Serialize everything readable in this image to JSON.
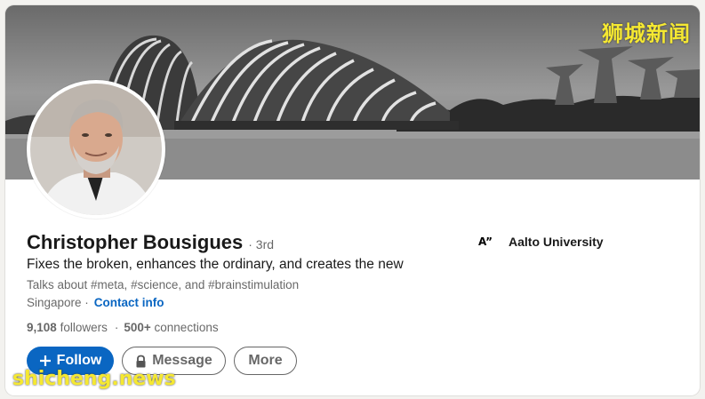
{
  "banner": {
    "watermark": "狮城新闻"
  },
  "profile": {
    "name": "Christopher Bousigues",
    "degree": "· 3rd",
    "headline": "Fixes the broken, enhances the ordinary, and creates the new",
    "talks_about": "Talks about #meta, #science, and #brainstimulation",
    "location": "Singapore ·",
    "contact_label": "Contact info",
    "followers": "9,108",
    "followers_label": "followers",
    "connections": "500+",
    "connections_label": "connections"
  },
  "education": {
    "logo_text": "A”",
    "name": "Aalto University"
  },
  "actions": {
    "follow_label": "Follow",
    "message_label": "Message",
    "more_label": "More"
  },
  "footer": {
    "watermark": "shicheng.news"
  },
  "colors": {
    "accent": "#0a66c2",
    "watermark": "#f5e832"
  }
}
